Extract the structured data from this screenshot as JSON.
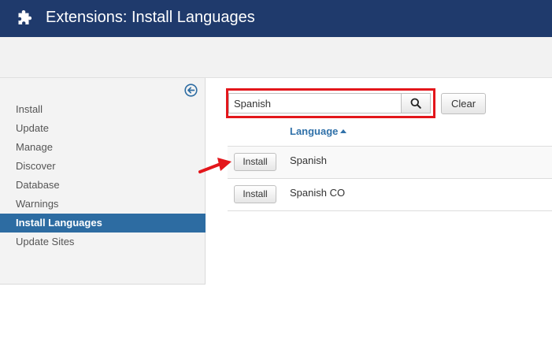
{
  "header": {
    "title": "Extensions: Install Languages",
    "icon": "puzzle-icon",
    "background": "#1f3a6c"
  },
  "sidebar": {
    "collapse_icon": "arrow-circle-left-icon",
    "items": [
      {
        "label": "Install",
        "active": false
      },
      {
        "label": "Update",
        "active": false
      },
      {
        "label": "Manage",
        "active": false
      },
      {
        "label": "Discover",
        "active": false
      },
      {
        "label": "Database",
        "active": false
      },
      {
        "label": "Warnings",
        "active": false
      },
      {
        "label": "Install Languages",
        "active": true
      },
      {
        "label": "Update Sites",
        "active": false
      }
    ],
    "active_color": "#2d6ca2"
  },
  "search": {
    "value": "Spanish",
    "search_icon": "magnifier-icon",
    "clear_label": "Clear",
    "highlight_color": "#e3161b"
  },
  "table": {
    "column_header": "Language",
    "sort": "ascending",
    "rows": [
      {
        "install_label": "Install",
        "language": "Spanish"
      },
      {
        "install_label": "Install",
        "language": "Spanish CO"
      }
    ]
  },
  "annotation": {
    "arrow_color": "#e3161b"
  }
}
